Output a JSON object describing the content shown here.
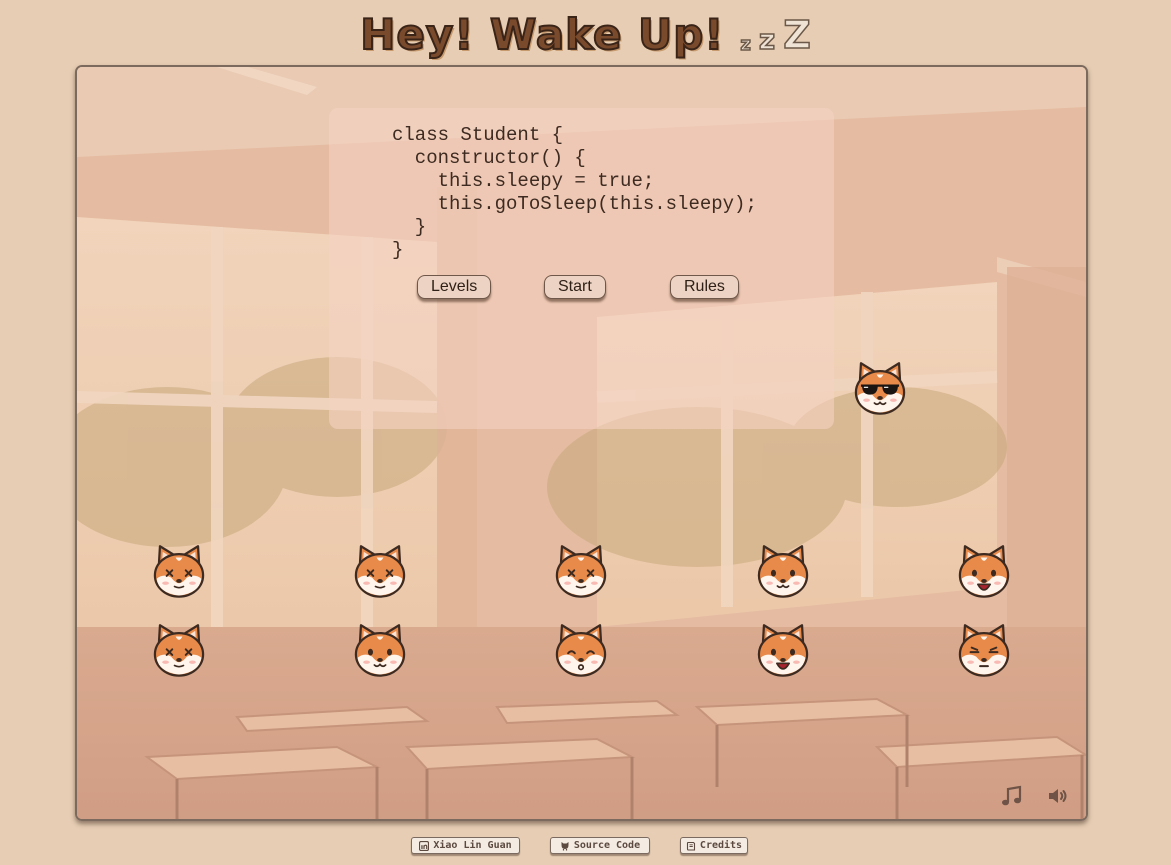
{
  "header": {
    "title": "Hey! Wake Up!",
    "zzz": [
      "z",
      "z",
      "Z"
    ]
  },
  "code_panel": {
    "lines": [
      "class Student {",
      "  constructor() {",
      "    this.sleepy = true;",
      "    this.goToSleep(this.sleepy);",
      "  }",
      "}"
    ]
  },
  "menu": {
    "levels_label": "Levels",
    "start_label": "Start",
    "rules_label": "Rules"
  },
  "students": {
    "teacher": "sunglasses",
    "row1": [
      "dizzy",
      "dizzy",
      "dizzy",
      "awake",
      "laughing"
    ],
    "row2": [
      "dizzy",
      "awake",
      "whistling",
      "laughing",
      "sleeping"
    ]
  },
  "controls": {
    "music_icon": "music-note-icon",
    "sound_icon": "speaker-icon"
  },
  "footer": {
    "author_label": "Xiao Lin Guan",
    "source_label": "Source Code",
    "credits_label": "Credits"
  },
  "colors": {
    "background": "#e6cdb3",
    "title": "#7a4a2c",
    "button_fill": "#ecd3c3",
    "shiba_orange": "#e88a4a"
  }
}
